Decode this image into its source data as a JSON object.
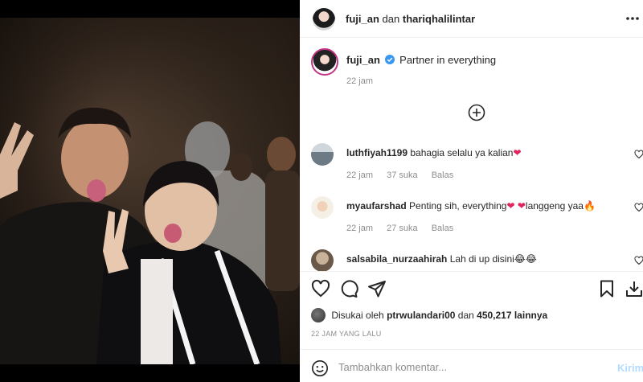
{
  "post": {
    "author": "fuji_an",
    "header_joiner": "dan",
    "collaborator": "thariqhalilintar",
    "caption": "Partner in everything",
    "caption_time": "22 jam"
  },
  "comments": [
    {
      "username": "luthfiyah1199",
      "text": "bahagia selalu ya kalian",
      "emoji": "❤",
      "time": "22 jam",
      "likes": "37 suka",
      "reply": "Balas"
    },
    {
      "username": "myaufarshad",
      "text_a": "Penting sih, everything",
      "emoji_a": "❤ ❤",
      "text_b": "langgeng yaa",
      "emoji_b": "🔥",
      "time": "22 jam",
      "likes": "27 suka",
      "reply": "Balas"
    },
    {
      "username": "salsabila_nurzaahirah",
      "text": "Lah di up disini",
      "emoji": "😂😂"
    }
  ],
  "likes": {
    "prefix": "Disukai oleh",
    "user": "ptrwulandari00",
    "joiner": "dan",
    "count": "450,217 lainnya"
  },
  "posted_ago": "22 JAM YANG LALU",
  "add_comment": {
    "placeholder": "Tambahkan komentar...",
    "post_label": "Kirim"
  },
  "icons": {
    "more": "more-horizontal-icon",
    "verified": "verified-badge-icon",
    "load_more": "plus-circle-icon",
    "like": "heart-icon",
    "comment": "comment-icon",
    "share": "send-icon",
    "save": "bookmark-icon",
    "download": "download-icon",
    "emoji": "smiley-icon"
  },
  "colors": {
    "verified": "#3897f0",
    "link_disabled": "#b3dbff",
    "muted": "#8e8e8e"
  }
}
